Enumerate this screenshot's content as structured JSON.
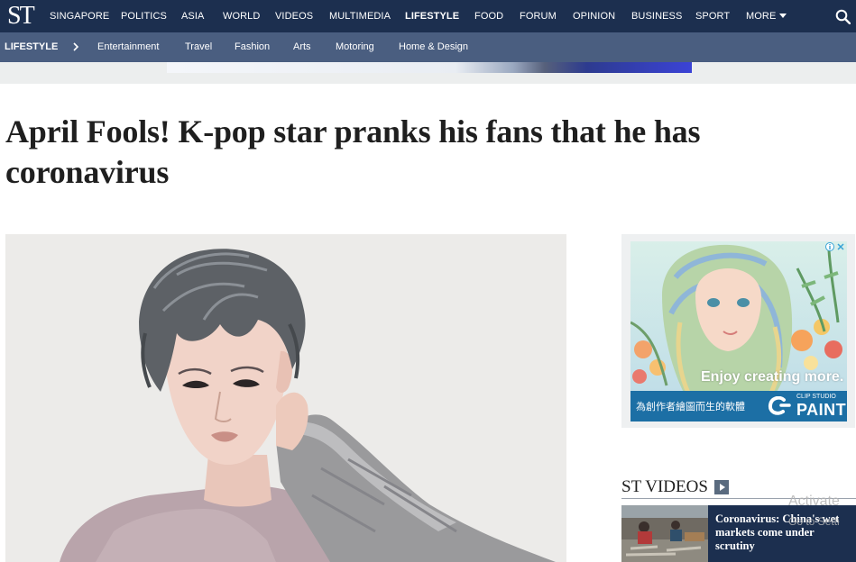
{
  "site": {
    "logo": "ST"
  },
  "topnav": {
    "items": [
      {
        "label": "SINGAPORE",
        "active": false
      },
      {
        "label": "POLITICS",
        "active": false
      },
      {
        "label": "ASIA",
        "active": false
      },
      {
        "label": "WORLD",
        "active": false
      },
      {
        "label": "VIDEOS",
        "active": false
      },
      {
        "label": "MULTIMEDIA",
        "active": false
      },
      {
        "label": "LIFESTYLE",
        "active": true
      },
      {
        "label": "FOOD",
        "active": false
      },
      {
        "label": "FORUM",
        "active": false
      },
      {
        "label": "OPINION",
        "active": false
      },
      {
        "label": "BUSINESS",
        "active": false
      },
      {
        "label": "SPORT",
        "active": false
      }
    ],
    "more_label": "MORE",
    "search_icon": "search-icon"
  },
  "subnav": {
    "section": "LIFESTYLE",
    "items": [
      "Entertainment",
      "Travel",
      "Fashion",
      "Arts",
      "Motoring",
      "Home & Design"
    ]
  },
  "article": {
    "headline": "April Fools! K-pop star pranks his fans that he has coronavirus"
  },
  "sidebar_ad": {
    "tagline": "Enjoy creating more.",
    "chinese_text": "為創作者繪圖而生的軟體",
    "brand_small": "CLIP STUDIO",
    "brand": "PAINT"
  },
  "st_videos": {
    "title": "ST VIDEOS",
    "items": [
      {
        "title": "Coronavirus: China's wet markets come under scrutiny"
      }
    ]
  },
  "watermark": {
    "line1": "Activate",
    "line2": "Go to Setti"
  },
  "colors": {
    "topnav_bg": "#1c2f4f",
    "subnav_bg": "#4a5e80",
    "ad_bar": "#1c6fa5"
  }
}
